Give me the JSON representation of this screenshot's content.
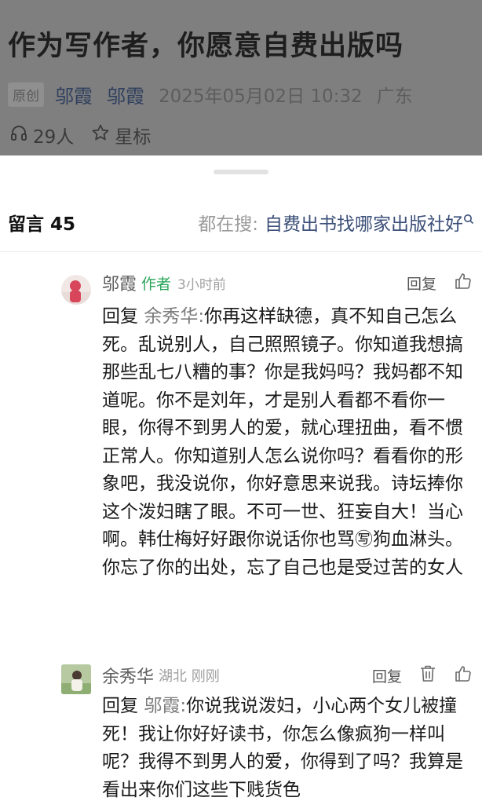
{
  "article": {
    "title": "作为写作者，你愿意自费出版吗",
    "badge": "原创",
    "author": "邬霞",
    "account": "邬霞",
    "date": "2025年05月02日 10:32",
    "region": "广东",
    "listeners": "29人",
    "star_label": "星标"
  },
  "comments_header": {
    "label": "留言",
    "count": "45",
    "search_prefix": "都在搜:",
    "search_term": "自费出书找哪家出版社好"
  },
  "comments": [
    {
      "name": "邬霞",
      "tag": "作者",
      "meta": "3小时前",
      "reply_label": "回复",
      "reply_prefix": "回复",
      "mention": "余秀华:",
      "text": "你再这样缺德，真不知自己怎么死。乱说别人，自己照照镜子。你知道我想搞那些乱七八糟的事？你是我妈吗？我妈都不知道呢。你不是刘年，才是别人看都不看你一眼，你得不到男人的爱，就心理扭曲，看不惯正常人。你知道别人怎么说你吗？看看你的形象吧，我没说你，你好意思来说我。诗坛捧你这个泼妇瞎了眼。不可一世、狂妄自大！当心啊。韩仕梅好好跟你说话你也骂㊢狗血淋头。你忘了你的出处，忘了自己也是受过苦的女人"
    },
    {
      "name": "余秀华",
      "tag": "",
      "meta": "湖北 刚刚",
      "reply_label": "回复",
      "reply_prefix": "回复",
      "mention": "邬霞:",
      "text": "你说我说泼妇，小心两个女儿被撞死！我让你好好读书，你怎么像疯狗一样叫呢？我得不到男人的爱，你得到了吗？我算是看出来你们这些下贱货色"
    }
  ],
  "colors": {
    "overlay": "#7f7f7f",
    "link": "#3b4f78",
    "author_tag": "#2aa65a"
  },
  "icons": [
    "headphones-icon",
    "star-icon",
    "search-icon",
    "thumbs-up-icon",
    "trash-icon"
  ]
}
